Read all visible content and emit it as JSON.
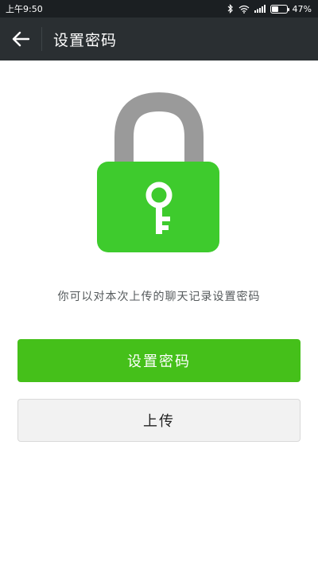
{
  "status_bar": {
    "time": "上午9:50",
    "battery_percent": "47%",
    "battery_level": 0.47,
    "icons": [
      "bluetooth-icon",
      "wifi-icon",
      "signal-icon",
      "battery-icon"
    ]
  },
  "action_bar": {
    "title": "设置密码",
    "back_icon": "arrow-left-icon"
  },
  "illustration": {
    "icon": "lock-with-key-icon",
    "lock_color": "#3ecb2d",
    "shackle_color": "#9a9a9a"
  },
  "hint": "你可以对本次上传的聊天记录设置密码",
  "buttons": {
    "set_password": "设置密码",
    "upload": "上传"
  },
  "colors": {
    "primary": "#45c01a",
    "toolbar": "#2a2f32",
    "status_bar": "#1b1f22"
  }
}
